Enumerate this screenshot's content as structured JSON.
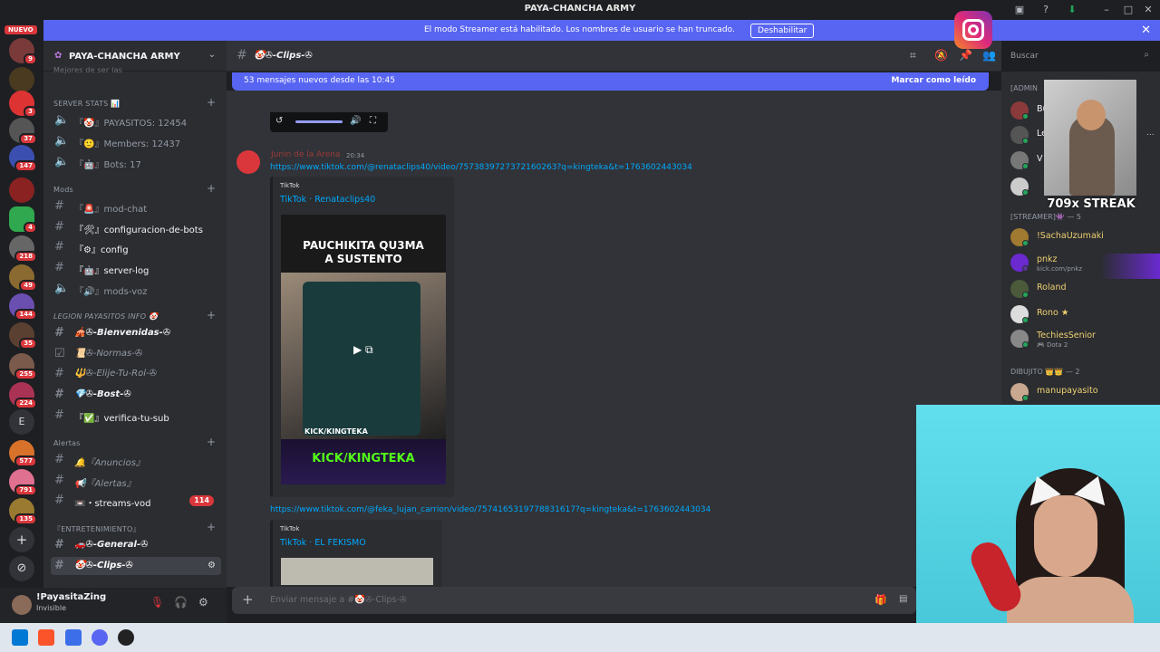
{
  "window": {
    "title": "PAYA-CHANCHA ARMY"
  },
  "banner": {
    "message": "El modo Streamer está habilitado. Los nombres de usuario se han truncado.",
    "button": "Deshabilitar"
  },
  "servers": {
    "nuevo_label": "NUEVO",
    "badges": [
      "9",
      "3",
      "37",
      "147",
      "4",
      "218",
      "49",
      "144",
      "35",
      "255",
      "224",
      "577",
      "791",
      "135"
    ],
    "letter_server": "E"
  },
  "server": {
    "name": "PAYA-CHANCHA ARMY"
  },
  "categories": {
    "partial": "Mejores de ser las",
    "server_stats": "SERVER STATS 📊",
    "mods": "Mods",
    "legion": "LEGION PAYASITOS INFO 🤡",
    "alertas": "Alertas",
    "entretenimiento": "『ENTRETENIMIENTO』"
  },
  "channels": {
    "stats": [
      "『🤡』PAYASITOS: 12454",
      "『🙂』Members: 12437",
      "『🤖』Bots: 17"
    ],
    "mods": [
      "『🚨』mod-chat",
      "『🛠』configuracion-de-bots",
      "『⚙』config",
      "『🤖』server-log",
      "『🔊』mods-voz"
    ],
    "legion": [
      "🎪✇-Bienvenidas-✇",
      "📜✇-Normas-✇",
      "🔱✇-Elije-Tu-Rol-✇",
      "💎✇-Bost-✇",
      "『✅』verifica-tu-sub"
    ],
    "alertas": [
      "🔔『Anuncios』",
      "📢『Alertas』",
      "📼・streams-vod"
    ],
    "alertas_count": "114",
    "entretenimiento": [
      "🚗✇-General-✇",
      "🤡✇-Clips-✇"
    ]
  },
  "user": {
    "name": "!PayasitaZing",
    "status": "Invisible"
  },
  "chat": {
    "channel_name": "🤡✇-Clips-✇",
    "new_messages": "53 mensajes nuevos desde las 10:45",
    "mark_read": "Marcar como leído",
    "composer_placeholder": "Enviar mensaje a #🤡✇-Clips-✇"
  },
  "message": {
    "author": "Junin de la Arena",
    "time": "20:34",
    "link1": "https://www.tiktok.com/@renataclips40/video/7573839727372160263?q=kingteka&t=1763602443034",
    "embed1_provider": "TikTok",
    "embed1_title": "TikTok · Renataclips40",
    "thumb_caption_line1": "PAUCHIKITA QU3MA",
    "thumb_caption_line2": "A SUSTENTO",
    "thumb_kick_small": "KICK/KINGTEKA",
    "thumb_kick_big": "KICK/KINGTEKA",
    "link2": "https://www.tiktok.com/@feka_lujan_carrion/video/7574165319778831617?q=kingteka&t=1763602443034",
    "embed2_provider": "TikTok",
    "embed2_title": "TikTok · EL FEKISMO"
  },
  "search": {
    "placeholder": "Buscar"
  },
  "members": {
    "admin_cat": "[ADMIN",
    "streamer_cat": "[STREAMER]👾 — 5",
    "dibujito_cat": "DIBUJITO 👑👑 — 2",
    "admins": [
      "Bu",
      "Le",
      "V",
      ""
    ],
    "admin_status": "...",
    "streamers": [
      {
        "name": "!SachaUzumaki",
        "sub": ""
      },
      {
        "name": "pnkz",
        "sub": "kick.com/pnkz"
      },
      {
        "name": "Roland",
        "sub": ""
      },
      {
        "name": "Rono ★",
        "sub": ""
      },
      {
        "name": "TechiesSenior",
        "sub": "🎮 Dota 2"
      }
    ],
    "dibujito": [
      {
        "name": "manupayasito",
        "sub": ""
      }
    ]
  },
  "overlay": {
    "streak": "709x STREAK"
  },
  "colors": {
    "blurple": "#5865f2",
    "danger": "#da373c",
    "link": "#00a8fc",
    "online": "#23a55a",
    "kick_green": "#53fc18"
  }
}
